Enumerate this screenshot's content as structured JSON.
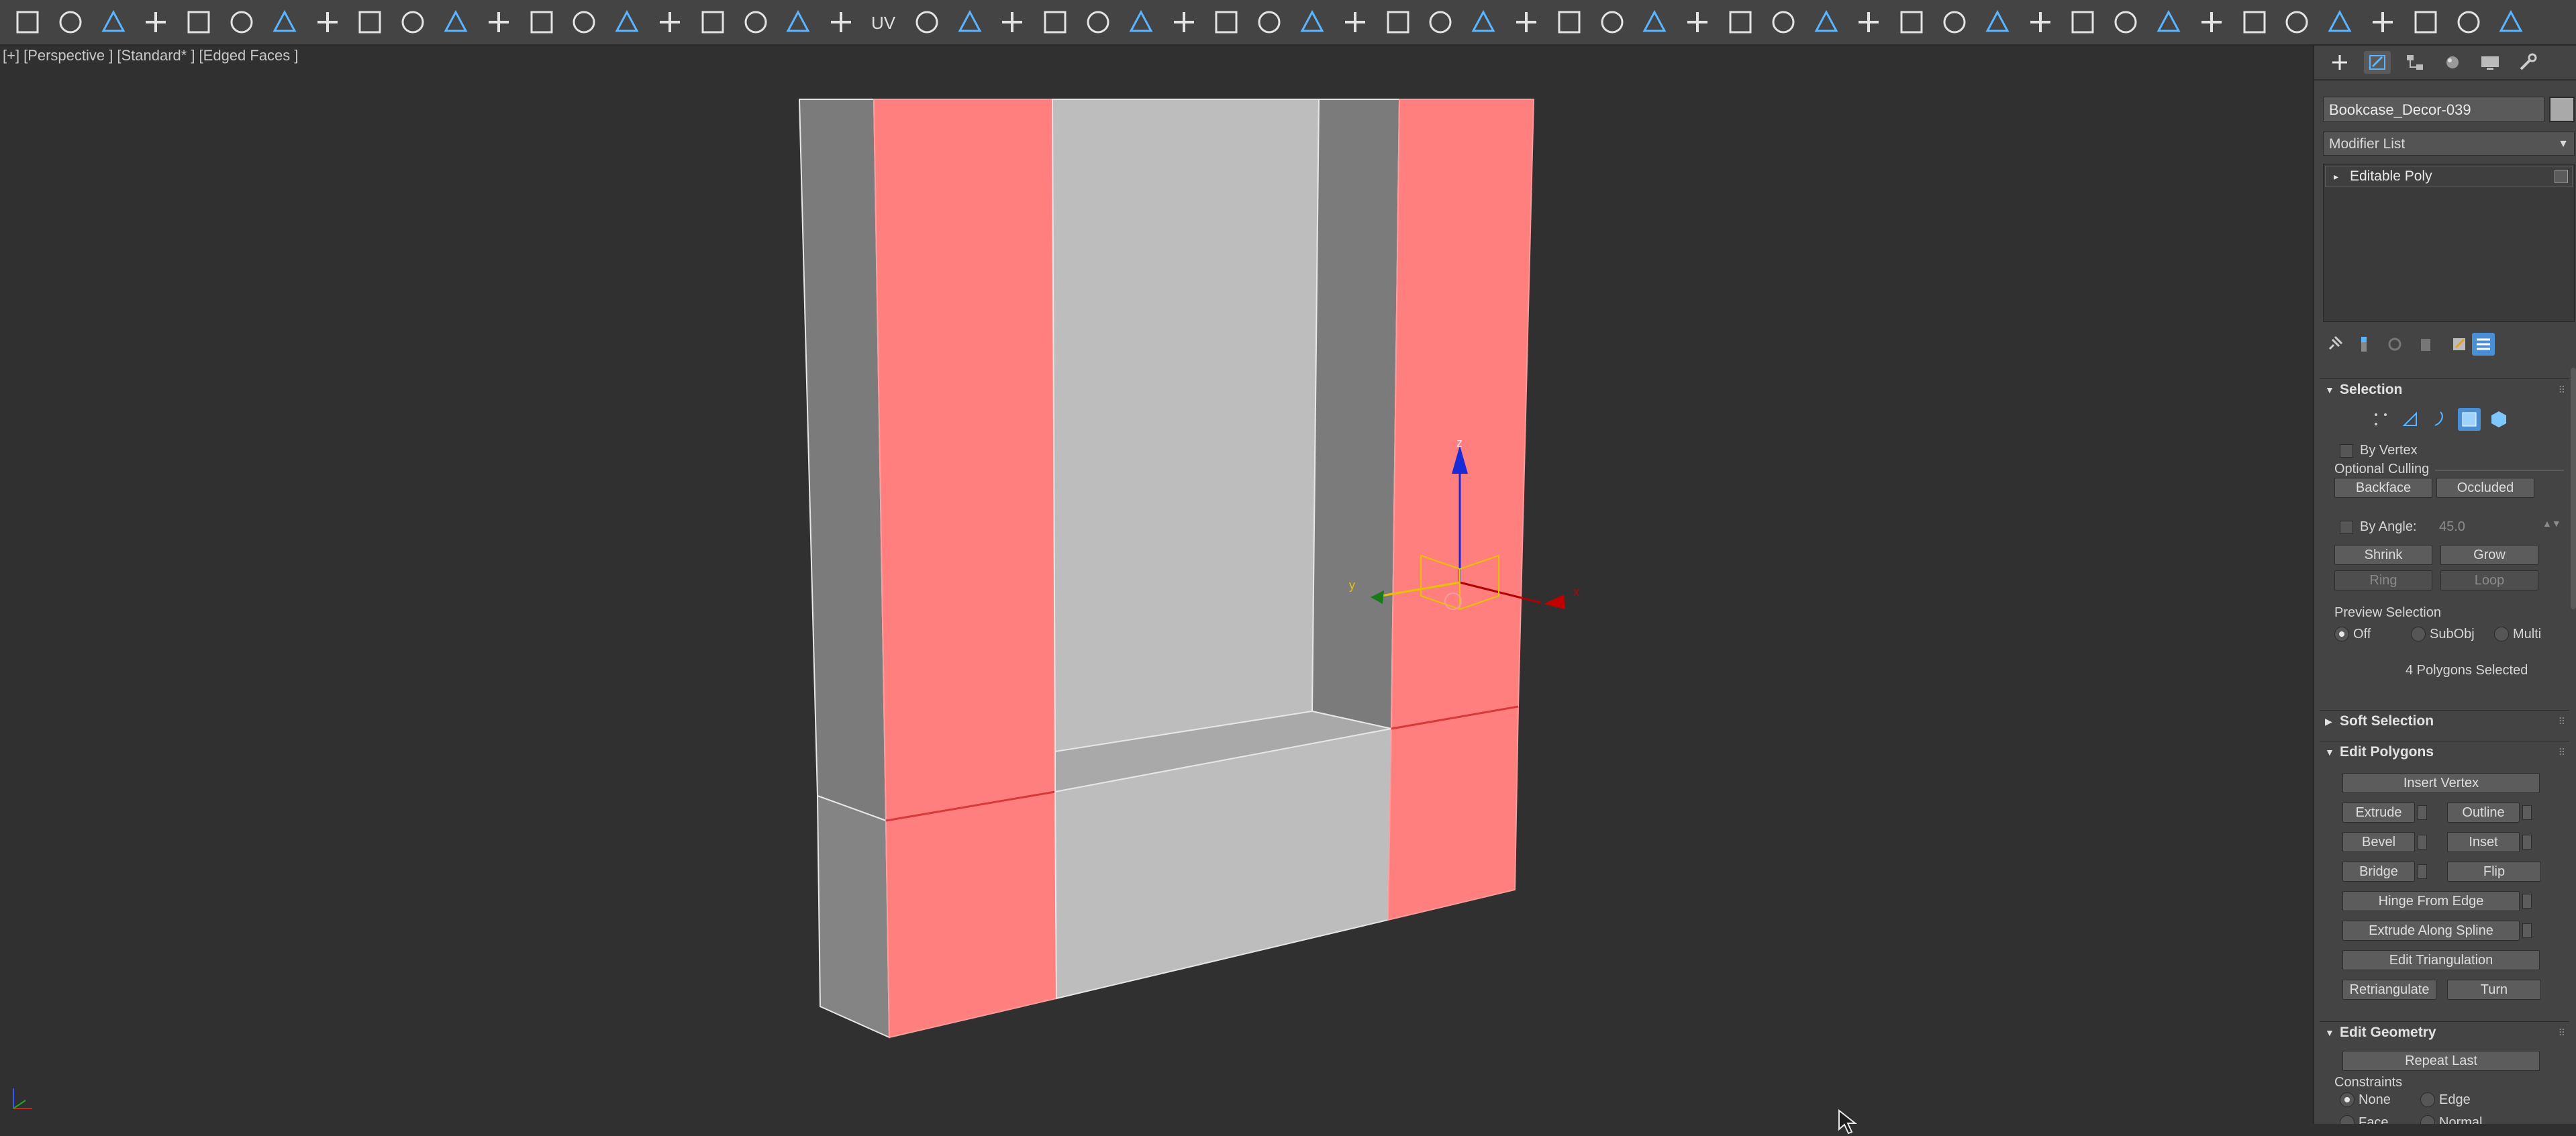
{
  "toolbar": {
    "icons": [
      "search-icon",
      "open-folder-icon",
      "display-icon",
      "create-icon",
      "select-region-icon",
      "layers-icon",
      "edit-icon",
      "link-icon",
      "new-scene-icon",
      "checklist-icon",
      "add-icon",
      "check-circle-icon",
      "toggle-icon",
      "eyedropper-icon",
      "paint-select-icon",
      "bind-icon",
      "lasso-icon",
      "snap-icon",
      "sphere-icon",
      "material-icon",
      "uv-icon",
      "eye-icon",
      "sun-icon",
      "light-icon",
      "flag-icon",
      "target-icon",
      "curve-icon",
      "scissors-icon",
      "torus-icon",
      "move-add-icon",
      "box-icon",
      "camera-icon",
      "camera2-icon",
      "camera3-icon",
      "camera4-icon",
      "camera5-icon",
      "play-icon",
      "lock-icon",
      "user-icon",
      "gear-icon",
      "refresh-icon",
      "panel-icon",
      "switch-icon",
      "crop-icon",
      "rotate-icon",
      "tweak-icon",
      "scale-icon",
      "down-arrow-icon",
      "up-arrow-icon",
      "align-icon",
      "globe-icon",
      "cube1-icon",
      "cube2-icon",
      "cube3-icon",
      "cube4-icon",
      "split-icon",
      "save-icon",
      "star-icon",
      "cloud-icon"
    ],
    "uv_label": "UV"
  },
  "viewport": {
    "label_parts": [
      "[+]",
      "[Perspective ]",
      "[Standard* ]",
      "[Edged Faces ]"
    ],
    "gizmo_axis_labels": {
      "z": "z",
      "y": "y",
      "x": "x"
    },
    "colors": {
      "selected_face": "#ff7f7f",
      "lit_face": "#bebebe",
      "shadow_face": "#8a8a8a",
      "side_face": "#7a7a7a"
    }
  },
  "panel": {
    "object_name": "Bookcase_Decor-039",
    "modifier_list": "Modifier List",
    "stack_item": "Editable Poly",
    "selection": {
      "title": "Selection",
      "by_vertex": "By Vertex",
      "optional_culling": "Optional Culling",
      "backface": "Backface",
      "occluded": "Occluded",
      "by_angle": "By Angle:",
      "angle_value": "45.0",
      "shrink": "Shrink",
      "grow": "Grow",
      "ring": "Ring",
      "loop": "Loop",
      "preview_selection": "Preview Selection",
      "off": "Off",
      "subobj": "SubObj",
      "multi": "Multi",
      "status": "4 Polygons Selected"
    },
    "soft_selection": "Soft Selection",
    "edit_polygons": {
      "title": "Edit Polygons",
      "insert_vertex": "Insert Vertex",
      "extrude": "Extrude",
      "outline": "Outline",
      "bevel": "Bevel",
      "inset": "Inset",
      "bridge": "Bridge",
      "flip": "Flip",
      "hinge": "Hinge From Edge",
      "extrude_spline": "Extrude Along Spline",
      "edit_triangulation": "Edit Triangulation",
      "retriangulate": "Retriangulate",
      "turn": "Turn"
    },
    "edit_geometry": {
      "title": "Edit Geometry",
      "repeat_last": "Repeat Last",
      "constraints": "Constraints",
      "none": "None",
      "edge": "Edge",
      "face": "Face",
      "normal": "Normal"
    }
  }
}
